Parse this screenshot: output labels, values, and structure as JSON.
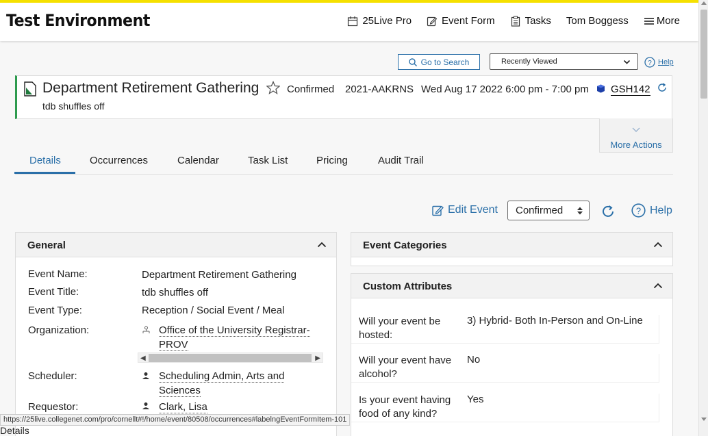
{
  "app": {
    "title": "Test Environment"
  },
  "nav": {
    "items": [
      {
        "label": "25Live Pro",
        "icon": "calendar-icon"
      },
      {
        "label": "Event Form",
        "icon": "edit-icon"
      },
      {
        "label": "Tasks",
        "icon": "clipboard-icon"
      },
      {
        "label": "Tom Boggess",
        "icon": ""
      },
      {
        "label": "More",
        "icon": "hamburger-icon"
      }
    ]
  },
  "search": {
    "goto_label": "Go to Search",
    "recent_label": "Recently Viewed",
    "help_label": "Help"
  },
  "event": {
    "name": "Department Retirement Gathering",
    "state": "Confirmed",
    "reference": "2021-AAKRNS",
    "datetime": "Wed Aug 17 2022 6:00 pm - 7:00 pm",
    "location": "GSH142",
    "title": "tdb shuffles off",
    "more_actions": "More Actions"
  },
  "tabs": [
    "Details",
    "Occurrences",
    "Calendar",
    "Task List",
    "Pricing",
    "Audit Trail"
  ],
  "actions": {
    "edit_label": "Edit Event",
    "state_value": "Confirmed",
    "help_label": "Help"
  },
  "general": {
    "heading": "General",
    "rows": [
      {
        "label": "Event Name:",
        "value": "Department Retirement Gathering"
      },
      {
        "label": "Event Title:",
        "value": "tdb shuffles off"
      },
      {
        "label": "Event Type:",
        "value": "Reception / Social Event / Meal"
      },
      {
        "label": "Organization:",
        "value_line1": "Office of the University Registrar-",
        "value_line2": "PROV"
      },
      {
        "label": "Scheduler:",
        "value_line1": "Scheduling Admin, Arts and",
        "value_line2": "Sciences"
      },
      {
        "label": "Requestor:",
        "value": "Clark, Lisa"
      }
    ]
  },
  "categories": {
    "heading": "Event Categories"
  },
  "custom": {
    "heading": "Custom Attributes",
    "rows": [
      {
        "q1": "Will your event be",
        "q2": "hosted:",
        "a": "3) Hybrid- Both In-Person and On-Line"
      },
      {
        "q1": "Will your event have",
        "q2": "alcohol?",
        "a": "No"
      },
      {
        "q1": "Is your event having",
        "q2": "food of any kind?",
        "a": "Yes"
      }
    ]
  },
  "status": {
    "url": "https://25live.collegenet.com/pro/cornellt#!/home/event/80508/occurrences#labelngEventFormItem-101",
    "bottom_label": "Details"
  },
  "colors": {
    "accent": "#2a6fa8",
    "brand_bar": "#f5e000",
    "event_bar": "#2e9b4e"
  }
}
